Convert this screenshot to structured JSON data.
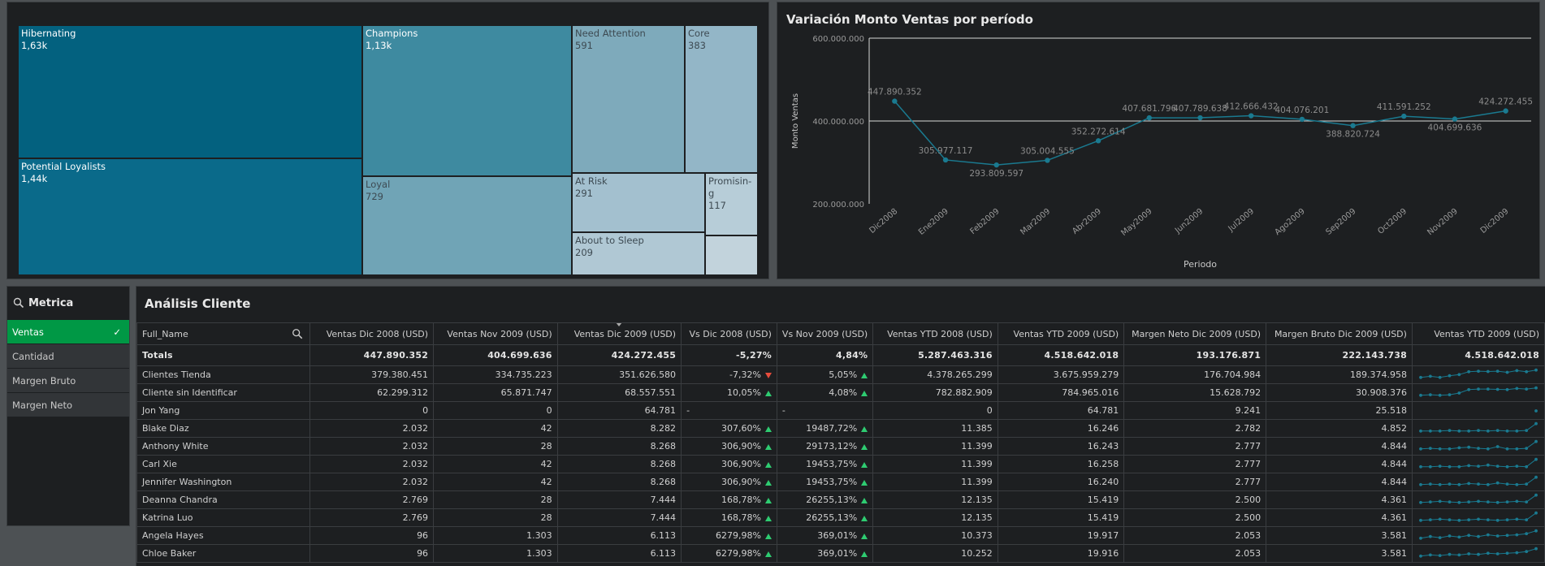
{
  "colors": {
    "background": "#4d5154",
    "panel": "#1d1f21",
    "line": "#1a7a90",
    "selected": "#009845",
    "up_arrow": "#2ecc71",
    "down_arrow": "#e74c3c"
  },
  "treemap": {
    "cells": [
      {
        "label": "Hibernating",
        "value": "1,63k",
        "color": "#03617f",
        "text": "dark"
      },
      {
        "label": "Potential Loyalists",
        "value": "1,44k",
        "color": "#0a6a8a",
        "text": "dark"
      },
      {
        "label": "Champions",
        "value": "1,13k",
        "color": "#3e8aa0",
        "text": "dark"
      },
      {
        "label": "Loyal",
        "value": "729",
        "color": "#70a4b6",
        "text": "light"
      },
      {
        "label": "Need Attention",
        "value": "591",
        "color": "#7eaabb",
        "text": "light"
      },
      {
        "label": "Core",
        "value": "383",
        "color": "#93b6c7",
        "text": "light"
      },
      {
        "label": "At Risk",
        "value": "291",
        "color": "#a3c0cf",
        "text": "light"
      },
      {
        "label": "Promisin-g",
        "value": "117",
        "color": "#b7cdd8",
        "text": "light"
      },
      {
        "label": "About to Sleep",
        "value": "209",
        "color": "#b0c8d4",
        "text": "light"
      },
      {
        "label": "",
        "value": "",
        "color": "#c2d3dc",
        "text": "light"
      }
    ]
  },
  "line_chart": {
    "title": "Variación Monto Ventas por período"
  },
  "chart_data": {
    "type": "line",
    "title": "Variación Monto Ventas por período",
    "xlabel": "Periodo",
    "ylabel": "Monto Ventas",
    "categories": [
      "Dic2008",
      "Ene2009",
      "Feb2009",
      "Mar2009",
      "Abr2009",
      "May2009",
      "Jun2009",
      "Jul2009",
      "Ago2009",
      "Sep2009",
      "Oct2009",
      "Nov2009",
      "Dic2009"
    ],
    "values": [
      447890352,
      305977117,
      293809597,
      305004555,
      352272614,
      407681796,
      407789638,
      412666432,
      404076201,
      388820724,
      411591252,
      404699636,
      424272455
    ],
    "value_labels": [
      "447.890.352",
      "305.977.117",
      "293.809.597",
      "305.004.555",
      "352.272.614",
      "407.681.796",
      "407.789.638",
      "412.666.432",
      "404.076.201",
      "388.820.724",
      "411.591.252",
      "404.699.636",
      "424.272.455"
    ],
    "ylim": [
      200000000,
      600000000
    ],
    "yticks": [
      200000000,
      400000000,
      600000000
    ],
    "ytick_labels": [
      "200.000.000",
      "400.000.000",
      "600.000.000"
    ],
    "grid": true
  },
  "metric": {
    "title": "Metrica",
    "items": [
      "Ventas",
      "Cantidad",
      "Margen Bruto",
      "Margen Neto"
    ],
    "selected": "Ventas"
  },
  "table": {
    "title": "Análisis Cliente",
    "columns": [
      "Full_Name",
      "Ventas Dic 2008 (USD)",
      "Ventas Nov 2009 (USD)",
      "Ventas Dic 2009 (USD)",
      "Vs Dic 2008 (USD)",
      "Vs Nov 2009 (USD)",
      "Ventas YTD 2008 (USD)",
      "Ventas YTD 2009 (USD)",
      "Margen Neto Dic 2009 (USD)",
      "Margen Bruto Dic 2009 (USD)",
      "Ventas YTD 2009 (USD)"
    ],
    "totals": [
      "Totals",
      "447.890.352",
      "404.699.636",
      "424.272.455",
      "-5,27%",
      "4,84%",
      "5.287.463.316",
      "4.518.642.018",
      "193.176.871",
      "222.143.738",
      "4.518.642.018"
    ],
    "rows": [
      {
        "cells": [
          "Clientes Tienda",
          "379.380.451",
          "334.735.223",
          "351.626.580",
          "-7,32%",
          "5,05%",
          "4.378.265.299",
          "3.675.959.279",
          "176.704.984",
          "189.374.958"
        ],
        "t1": "down",
        "t2": "up",
        "spark": [
          0.3,
          0.4,
          0.3,
          0.45,
          0.55,
          0.8,
          0.85,
          0.82,
          0.85,
          0.75,
          0.9,
          0.8,
          0.95
        ]
      },
      {
        "cells": [
          "Cliente sin Identificar",
          "62.299.312",
          "65.871.747",
          "68.557.551",
          "10,05%",
          "4,08%",
          "782.882.909",
          "784.965.016",
          "15.628.792",
          "30.908.376"
        ],
        "t1": "up",
        "t2": "up",
        "spark": [
          0.3,
          0.35,
          0.3,
          0.35,
          0.5,
          0.8,
          0.85,
          0.85,
          0.82,
          0.8,
          0.9,
          0.85,
          0.95
        ]
      },
      {
        "cells": [
          "Jon Yang",
          "0",
          "0",
          "64.781",
          "-",
          "-",
          "0",
          "64.781",
          "9.241",
          "25.518"
        ],
        "t1": "",
        "t2": "",
        "spark": [
          null,
          null,
          null,
          null,
          null,
          null,
          null,
          null,
          null,
          null,
          null,
          null,
          0.5
        ]
      },
      {
        "cells": [
          "Blake Diaz",
          "2.032",
          "42",
          "8.282",
          "307,60%",
          "19487,72%",
          "11.385",
          "16.246",
          "2.782",
          "4.852"
        ],
        "t1": "up",
        "t2": "up",
        "spark": [
          0.3,
          0.3,
          0.3,
          0.35,
          0.3,
          0.3,
          0.35,
          0.3,
          0.35,
          0.3,
          0.3,
          0.35,
          0.95
        ]
      },
      {
        "cells": [
          "Anthony White",
          "2.032",
          "28",
          "8.268",
          "306,90%",
          "29173,12%",
          "11.399",
          "16.243",
          "2.777",
          "4.844"
        ],
        "t1": "up",
        "t2": "up",
        "spark": [
          0.3,
          0.35,
          0.3,
          0.3,
          0.4,
          0.45,
          0.35,
          0.3,
          0.5,
          0.3,
          0.3,
          0.35,
          0.95
        ]
      },
      {
        "cells": [
          "Carl Xie",
          "2.032",
          "42",
          "8.268",
          "306,90%",
          "19453,75%",
          "11.399",
          "16.258",
          "2.777",
          "4.844"
        ],
        "t1": "up",
        "t2": "up",
        "spark": [
          0.3,
          0.3,
          0.35,
          0.3,
          0.3,
          0.4,
          0.35,
          0.45,
          0.35,
          0.3,
          0.35,
          0.3,
          0.95
        ]
      },
      {
        "cells": [
          "Jennifer Washington",
          "2.032",
          "42",
          "8.268",
          "306,90%",
          "19453,75%",
          "11.399",
          "16.240",
          "2.777",
          "4.844"
        ],
        "t1": "up",
        "t2": "up",
        "spark": [
          0.3,
          0.35,
          0.3,
          0.35,
          0.3,
          0.4,
          0.35,
          0.3,
          0.45,
          0.35,
          0.3,
          0.35,
          0.95
        ]
      },
      {
        "cells": [
          "Deanna Chandra",
          "2.769",
          "28",
          "7.444",
          "168,78%",
          "26255,13%",
          "12.135",
          "15.419",
          "2.500",
          "4.361"
        ],
        "t1": "up",
        "t2": "up",
        "spark": [
          0.3,
          0.35,
          0.4,
          0.35,
          0.3,
          0.35,
          0.4,
          0.35,
          0.3,
          0.35,
          0.4,
          0.35,
          0.95
        ]
      },
      {
        "cells": [
          "Katrina Luo",
          "2.769",
          "28",
          "7.444",
          "168,78%",
          "26255,13%",
          "12.135",
          "15.419",
          "2.500",
          "4.361"
        ],
        "t1": "up",
        "t2": "up",
        "spark": [
          0.3,
          0.35,
          0.4,
          0.35,
          0.3,
          0.35,
          0.4,
          0.35,
          0.3,
          0.35,
          0.4,
          0.35,
          0.95
        ]
      },
      {
        "cells": [
          "Angela Hayes",
          "96",
          "1.303",
          "6.113",
          "6279,98%",
          "369,01%",
          "10.373",
          "19.917",
          "2.053",
          "3.581"
        ],
        "t1": "up",
        "t2": "up",
        "spark": [
          0.3,
          0.45,
          0.35,
          0.5,
          0.4,
          0.55,
          0.45,
          0.6,
          0.5,
          0.55,
          0.6,
          0.7,
          0.95
        ]
      },
      {
        "cells": [
          "Chloe Baker",
          "96",
          "1.303",
          "6.113",
          "6279,98%",
          "369,01%",
          "10.252",
          "19.916",
          "2.053",
          "3.581"
        ],
        "t1": "up",
        "t2": "up",
        "spark": [
          0.3,
          0.4,
          0.35,
          0.45,
          0.4,
          0.5,
          0.45,
          0.55,
          0.5,
          0.55,
          0.6,
          0.7,
          0.95
        ]
      }
    ]
  }
}
